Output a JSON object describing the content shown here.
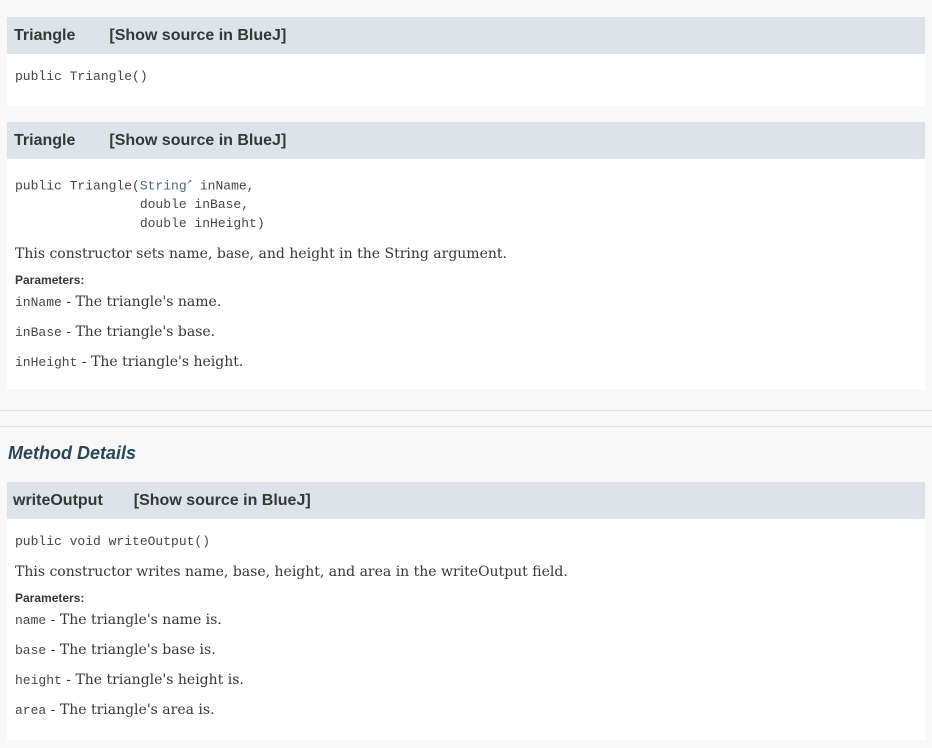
{
  "constructor1": {
    "name": "Triangle",
    "source_link": "[Show source in BlueJ]",
    "signature": "public Triangle()"
  },
  "constructor2": {
    "name": "Triangle",
    "source_link": "[Show source in BlueJ]",
    "sig_prefix": "public Triangle(",
    "sig_type_link": "String",
    "sig_line1_rest": " inName,",
    "sig_line2": "                double inBase,",
    "sig_line3": "                double inHeight)",
    "description": "This constructor sets name, base, and height in the String argument.",
    "params_label": "Parameters:",
    "params": [
      {
        "name": "inName",
        "desc": " - The triangle's name."
      },
      {
        "name": "inBase",
        "desc": " - The triangle's base."
      },
      {
        "name": "inHeight",
        "desc": " - The triangle's height."
      }
    ]
  },
  "method_details_title": "Method Details",
  "method1": {
    "name": "writeOutput",
    "source_link": "[Show source in BlueJ]",
    "signature": "public void writeOutput()",
    "description": "This constructor writes name, base, height, and area in the writeOutput field.",
    "params_label": "Parameters:",
    "params": [
      {
        "name": "name",
        "desc": " - The triangle's name is."
      },
      {
        "name": "base",
        "desc": " - The triangle's base is."
      },
      {
        "name": "height",
        "desc": " - The triangle's height is."
      },
      {
        "name": "area",
        "desc": " - The triangle's area is."
      }
    ]
  }
}
